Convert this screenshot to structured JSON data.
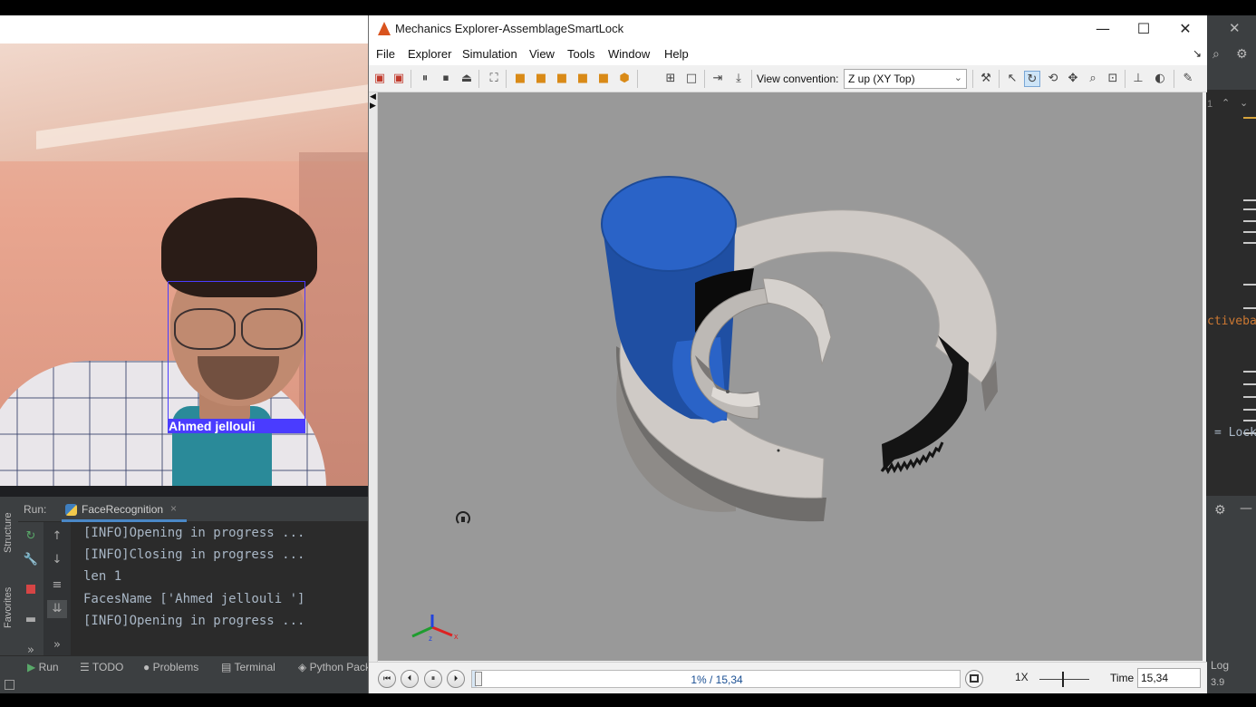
{
  "webcam": {
    "recognized_name": "Ahmed jellouli"
  },
  "ide": {
    "side_tabs": [
      "Structure",
      "Favorites"
    ],
    "run_label": "Run:",
    "run_tab": "FaceRecognition",
    "console_lines": [
      "[INFO]Opening in progress ...",
      "[INFO]Closing in progress ...",
      "len 1",
      "FacesName ['Ahmed jellouli ']",
      "[INFO]Opening in progress ..."
    ],
    "bottom_tabs": [
      "Run",
      "TODO",
      "Problems",
      "Terminal",
      "Python Packages"
    ],
    "right_code_fragments": [
      "ctiveba",
      "= Lock"
    ],
    "right_top_number": "1",
    "right_bottom_labels": [
      "Log",
      "3.9"
    ]
  },
  "mechanics": {
    "window_title": "Mechanics Explorer-AssemblageSmartLock",
    "menus": [
      "File",
      "Explorer",
      "Simulation",
      "View",
      "Tools",
      "Window",
      "Help"
    ],
    "view_convention_label": "View convention:",
    "view_convention_value": "Z up (XY Top)",
    "viewport_bg": "#999999",
    "model_colors": {
      "blue_cylinder": "#2a63c7",
      "gray_part": "#cfcac6",
      "dark_teeth": "#111111"
    },
    "triad_labels": {
      "x": "x",
      "z": "z"
    },
    "playback": {
      "progress_text": "1% / 15,34",
      "progress_fraction": 0.01,
      "speed": "1X",
      "time_label": "Time",
      "time_value": "15,34"
    }
  }
}
